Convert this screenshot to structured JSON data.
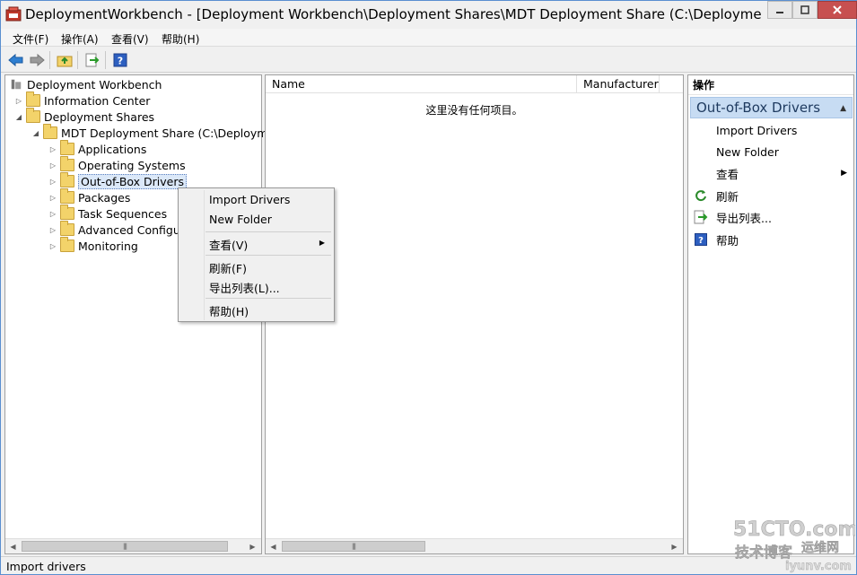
{
  "window": {
    "title": "DeploymentWorkbench - [Deployment Workbench\\Deployment Shares\\MDT Deployment Share (C:\\DeploymentS..."
  },
  "menu": {
    "items": [
      {
        "label": "文件(F)"
      },
      {
        "label": "操作(A)"
      },
      {
        "label": "查看(V)"
      },
      {
        "label": "帮助(H)"
      }
    ]
  },
  "toolbar": {
    "icons": [
      "back-arrow-icon",
      "forward-arrow-icon",
      "up-folder-icon",
      "export-list-icon",
      "help-icon"
    ]
  },
  "tree": {
    "root": "Deployment Workbench",
    "info_center": "Information Center",
    "deployment_shares": "Deployment Shares",
    "mdt_share": "MDT Deployment Share (C:\\Deployme",
    "children": [
      {
        "label": "Applications"
      },
      {
        "label": "Operating Systems"
      },
      {
        "label": "Out-of-Box Drivers"
      },
      {
        "label": "Packages"
      },
      {
        "label": "Task Sequences"
      },
      {
        "label": "Advanced Configur"
      },
      {
        "label": "Monitoring"
      }
    ]
  },
  "list": {
    "columns": [
      "Name",
      "Manufacturer"
    ],
    "empty_message": "这里没有任何项目。"
  },
  "actions": {
    "title": "操作",
    "group": "Out-of-Box Drivers",
    "items": [
      {
        "label": "Import Drivers"
      },
      {
        "label": "New Folder"
      },
      {
        "label": "查看"
      },
      {
        "label": "刷新"
      },
      {
        "label": "导出列表..."
      },
      {
        "label": "帮助"
      }
    ]
  },
  "context_menu": {
    "items": [
      {
        "label": "Import Drivers"
      },
      {
        "label": "New Folder"
      },
      {
        "label": "查看(V)"
      },
      {
        "label": "刷新(F)"
      },
      {
        "label": "导出列表(L)..."
      },
      {
        "label": "帮助(H)"
      }
    ]
  },
  "status": {
    "text": "Import drivers"
  },
  "watermark": {
    "line1": "51CTO.com",
    "line2": "技术博客",
    "line3": "运维网",
    "line4": "iyunv.com"
  },
  "colors": {
    "selection": "#dbe8f8",
    "action_group": "#c7dcf3",
    "folder": "#f3d36a"
  }
}
